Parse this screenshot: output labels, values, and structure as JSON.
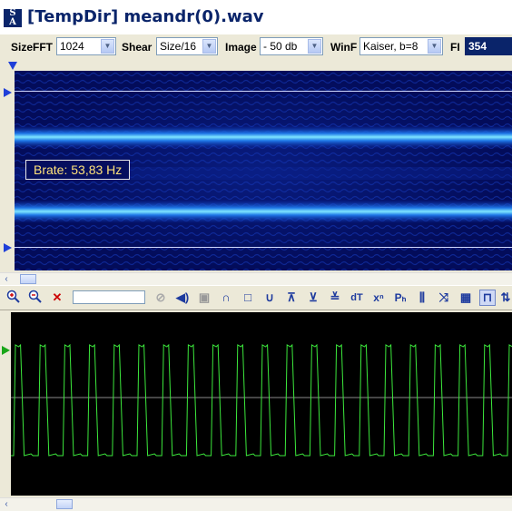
{
  "window": {
    "title": "[TempDir] meandr(0).wav",
    "app_icon_text": [
      "S",
      "A"
    ]
  },
  "toolbar": {
    "sizefft_label": "SizeFFT",
    "sizefft_value": "1024",
    "shear_label": "Shear",
    "shear_value": "Size/16",
    "image_label": "Image",
    "image_value": "- 50 db",
    "winf_label": "WinF",
    "winf_value": "Kaiser, b=8",
    "fi_label": "FI",
    "fi_value": "354"
  },
  "spectrogram": {
    "brate_label": "Brate: 53,83 Hz",
    "band_color": "#5ad0ff",
    "background_color": "#030c5a"
  },
  "iconbar": {
    "icons": [
      "zoom-in-icon",
      "zoom-out-icon",
      "clear-zoom-icon",
      "disabled-icon",
      "speaker-icon",
      "stop-icon",
      "arc-up-icon",
      "square-wave-icon",
      "arc-down-icon",
      "peak-up-icon",
      "peak-down-icon",
      "peaks-icon",
      "dt-icon",
      "x-power-icon",
      "p-sub-icon",
      "bars-icon",
      "comb-icon",
      "cross-icon",
      "grid-icon",
      "pulse-icon",
      "up-down-icon"
    ],
    "dt_text": "dT",
    "xn_text": "xⁿ",
    "ph_text": "Pₕ"
  },
  "oscilloscope": {
    "trace_color": "#3ce83c",
    "background_color": "#000000"
  },
  "scroll_arrow": "‹"
}
